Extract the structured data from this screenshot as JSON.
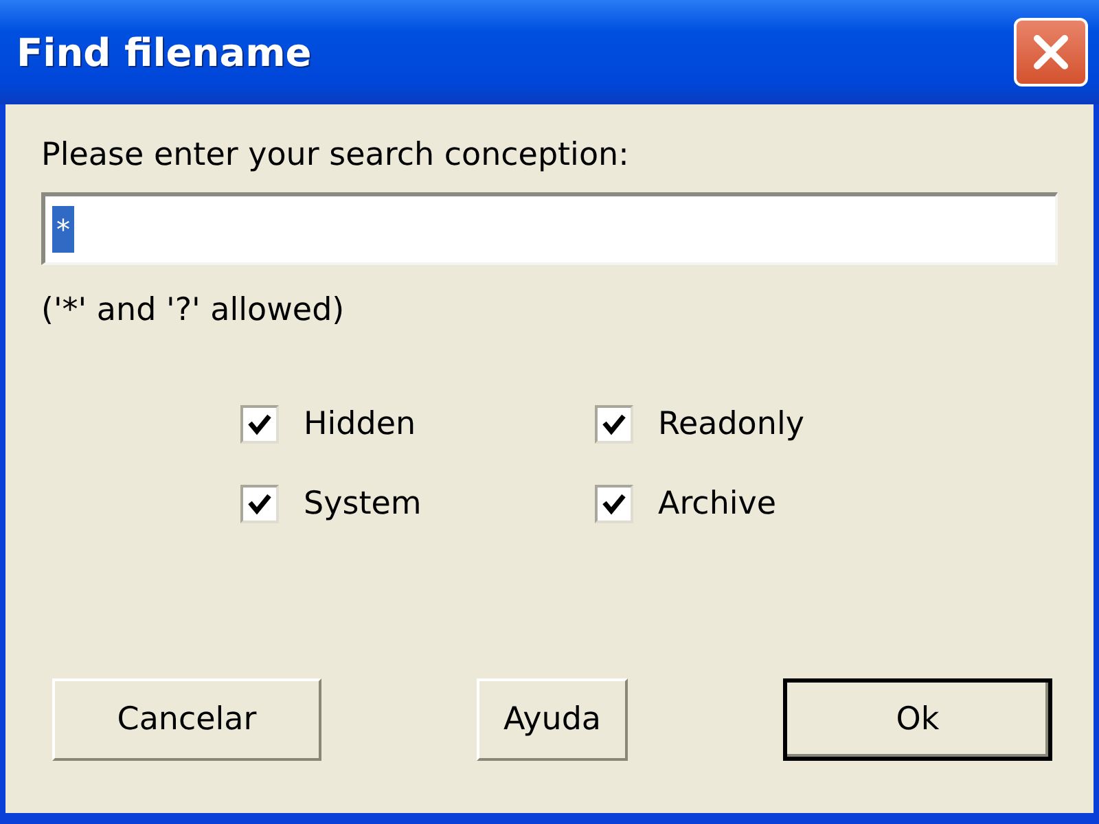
{
  "window": {
    "title": "Find filename"
  },
  "prompt": "Please enter your search conception:",
  "search": {
    "value": "*",
    "selected_text": true
  },
  "hint": "('*' and '?' allowed)",
  "options": [
    {
      "label": "Hidden",
      "checked": true
    },
    {
      "label": "Readonly",
      "checked": true
    },
    {
      "label": "System",
      "checked": true
    },
    {
      "label": "Archive",
      "checked": true
    }
  ],
  "buttons": [
    {
      "label": "Cancelar",
      "default": false
    },
    {
      "label": "Ayuda",
      "default": false
    },
    {
      "label": "Ok",
      "default": true
    }
  ]
}
